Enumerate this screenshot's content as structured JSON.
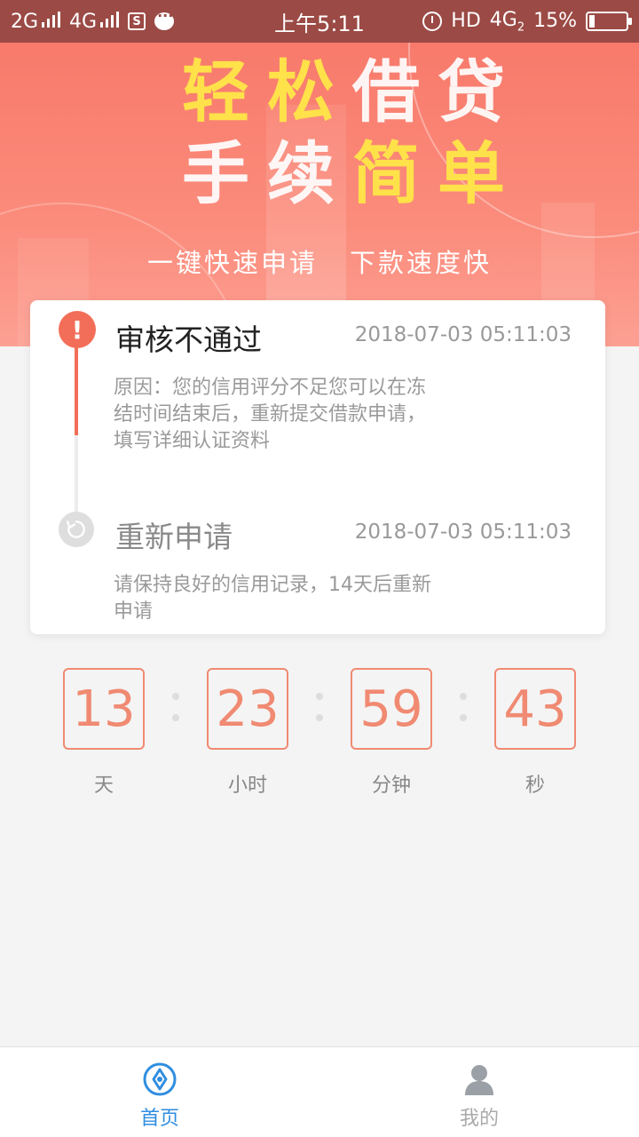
{
  "status_bar": {
    "signal1": "2G",
    "signal2": "4G",
    "time": "上午5:11",
    "hd": "HD",
    "net": "4G",
    "net_sub": "2",
    "battery": "15%",
    "battery_level": 0.15
  },
  "banner": {
    "headline_1a": "轻松",
    "headline_1b": "借贷",
    "headline_2a": "手续",
    "headline_2b": "简单",
    "slogan_1": "一键快速申请",
    "slogan_2": "下款速度快"
  },
  "card": {
    "step1": {
      "title": "审核不通过",
      "time": "2018-07-03 05:11:03",
      "desc": "原因：您的信用评分不足您可以在冻结时间结束后，重新提交借款申请，填写详细认证资料"
    },
    "step2": {
      "title": "重新申请",
      "time": "2018-07-03 05:11:03",
      "desc": "请保持良好的信用记录，14天后重新申请"
    }
  },
  "countdown": {
    "days": "13",
    "hours": "23",
    "minutes": "59",
    "seconds": "43",
    "days_label": "天",
    "hours_label": "小时",
    "minutes_label": "分钟",
    "seconds_label": "秒"
  },
  "nav": {
    "home": "首页",
    "mine": "我的"
  },
  "colors": {
    "accent": "#f26e58",
    "nav_active": "#2f8ee0"
  }
}
